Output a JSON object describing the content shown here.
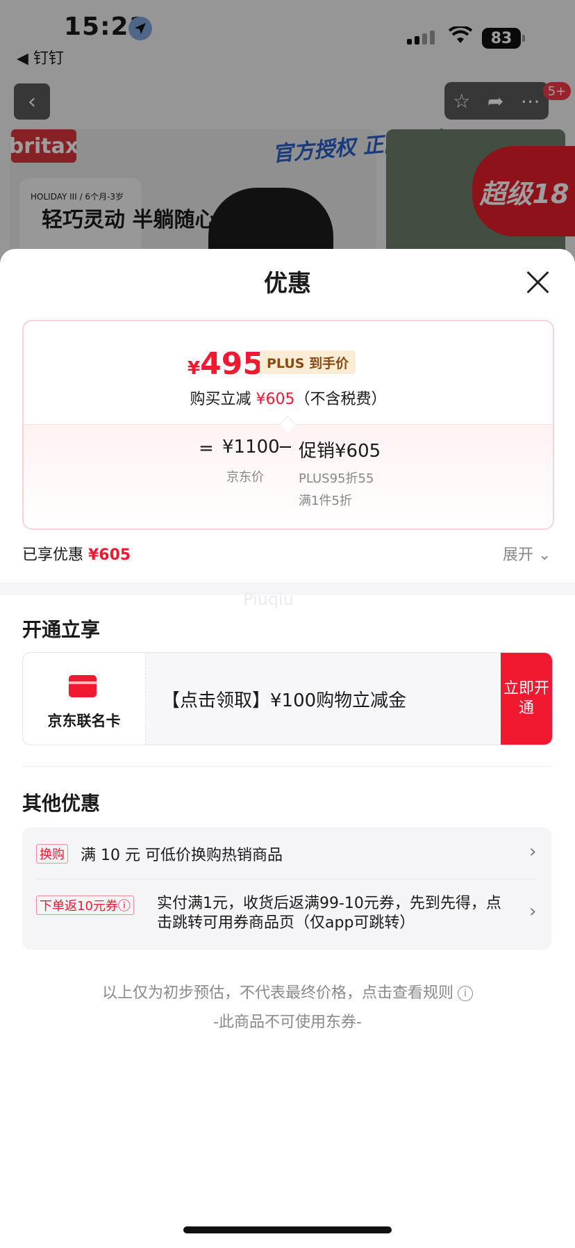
{
  "status_bar": {
    "time": "15:21",
    "back_app": "◀ 钉钉",
    "battery": "83"
  },
  "background_page": {
    "badge": "5+",
    "brand": "britax",
    "promo_small": "HOLIDAY III / 6个月-3岁",
    "promo_big": "轻巧灵动 半躺随心",
    "auth_text": "官方授权 正品保障",
    "super_text": "超级18"
  },
  "sheet": {
    "title": "优惠",
    "price_card": {
      "currency": "¥",
      "final_price": "495",
      "plus_tag": "PLUS 到手价",
      "buy_prefix": "购买立减 ",
      "buy_amount": "¥605",
      "buy_suffix": "（不含税费）",
      "eq": "=",
      "orig_price": "¥1100",
      "orig_label": "京东价",
      "minus": "−",
      "promo_price": "促销¥605",
      "promo_detail_1": "PLUS95折55",
      "promo_detail_2": "满1件5折"
    },
    "enjoyed_label": "已享优惠 ",
    "enjoyed_amount": "¥605",
    "expand_label": "展开",
    "watermark": "Piuqiu",
    "section_open": {
      "title": "开通立享",
      "card_label": "京东联名卡",
      "text": "【点击领取】¥100购物立减金",
      "button": "立即开通"
    },
    "section_other": {
      "title": "其他优惠",
      "row1_tag": "换购",
      "row1_text": "满 10 元 可低价换购热销商品",
      "row2_tag": "下单返10元券ⓘ",
      "row2_text": "实付满1元，收货后返满99-10元券，先到先得，点击跳转可用券商品页（仅app可跳转）"
    },
    "note_1": "以上仅为初步预估，不代表最终价格，点击查看规则",
    "note_2": "-此商品不可使用东券-"
  },
  "colors": {
    "accent_red": "#f0192f",
    "plus_tag_bg": "#fbecd6",
    "plus_tag_text": "#8a4a13"
  }
}
